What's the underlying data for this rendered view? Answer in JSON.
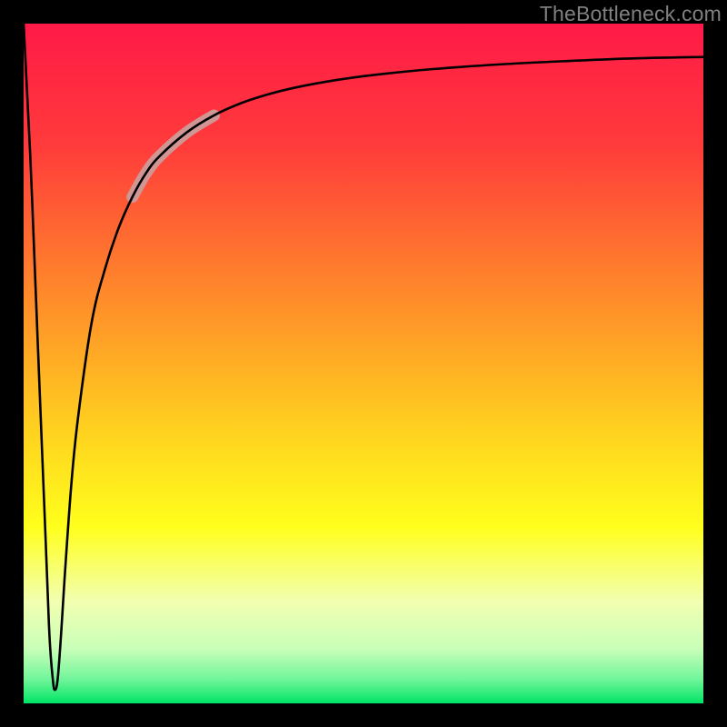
{
  "watermark": {
    "text": "TheBottleneck.com"
  },
  "colors": {
    "frame": "#000000",
    "curve": "#000000",
    "highlight": "#cf9694",
    "gradient_stops": [
      {
        "offset": 0.0,
        "color": "#ff1a47"
      },
      {
        "offset": 0.18,
        "color": "#ff3b3b"
      },
      {
        "offset": 0.4,
        "color": "#ff8a2a"
      },
      {
        "offset": 0.6,
        "color": "#ffd21f"
      },
      {
        "offset": 0.74,
        "color": "#ffff1c"
      },
      {
        "offset": 0.85,
        "color": "#f2ffb0"
      },
      {
        "offset": 0.92,
        "color": "#c8ffb8"
      },
      {
        "offset": 0.965,
        "color": "#70f59a"
      },
      {
        "offset": 1.0,
        "color": "#00e565"
      }
    ]
  },
  "chart_data": {
    "type": "line",
    "title": "",
    "xlabel": "",
    "ylabel": "",
    "xlim": [
      0,
      100
    ],
    "ylim": [
      0,
      100
    ],
    "grid": false,
    "legend": false,
    "series": [
      {
        "name": "bottleneck-curve",
        "x": [
          0.0,
          1.0,
          2.0,
          3.2,
          3.8,
          4.3,
          4.6,
          5.0,
          5.5,
          6.0,
          7.0,
          8.0,
          10.0,
          12.0,
          14.0,
          16.0,
          18.0,
          20.0,
          24.0,
          28.0,
          32.0,
          36.0,
          40.0,
          46.0,
          52.0,
          60.0,
          70.0,
          80.0,
          90.0,
          100.0
        ],
        "y": [
          100.0,
          80.0,
          55.0,
          25.0,
          10.0,
          3.5,
          2.0,
          3.5,
          10.0,
          18.0,
          32.0,
          42.0,
          56.0,
          64.0,
          70.0,
          74.5,
          78.0,
          80.5,
          84.0,
          86.5,
          88.3,
          89.6,
          90.6,
          91.7,
          92.5,
          93.3,
          94.0,
          94.5,
          94.9,
          95.1
        ]
      }
    ],
    "highlight_segment": {
      "x_start": 18.0,
      "x_end": 26.0
    },
    "minimum": {
      "x": 4.6,
      "y": 2.0
    }
  }
}
